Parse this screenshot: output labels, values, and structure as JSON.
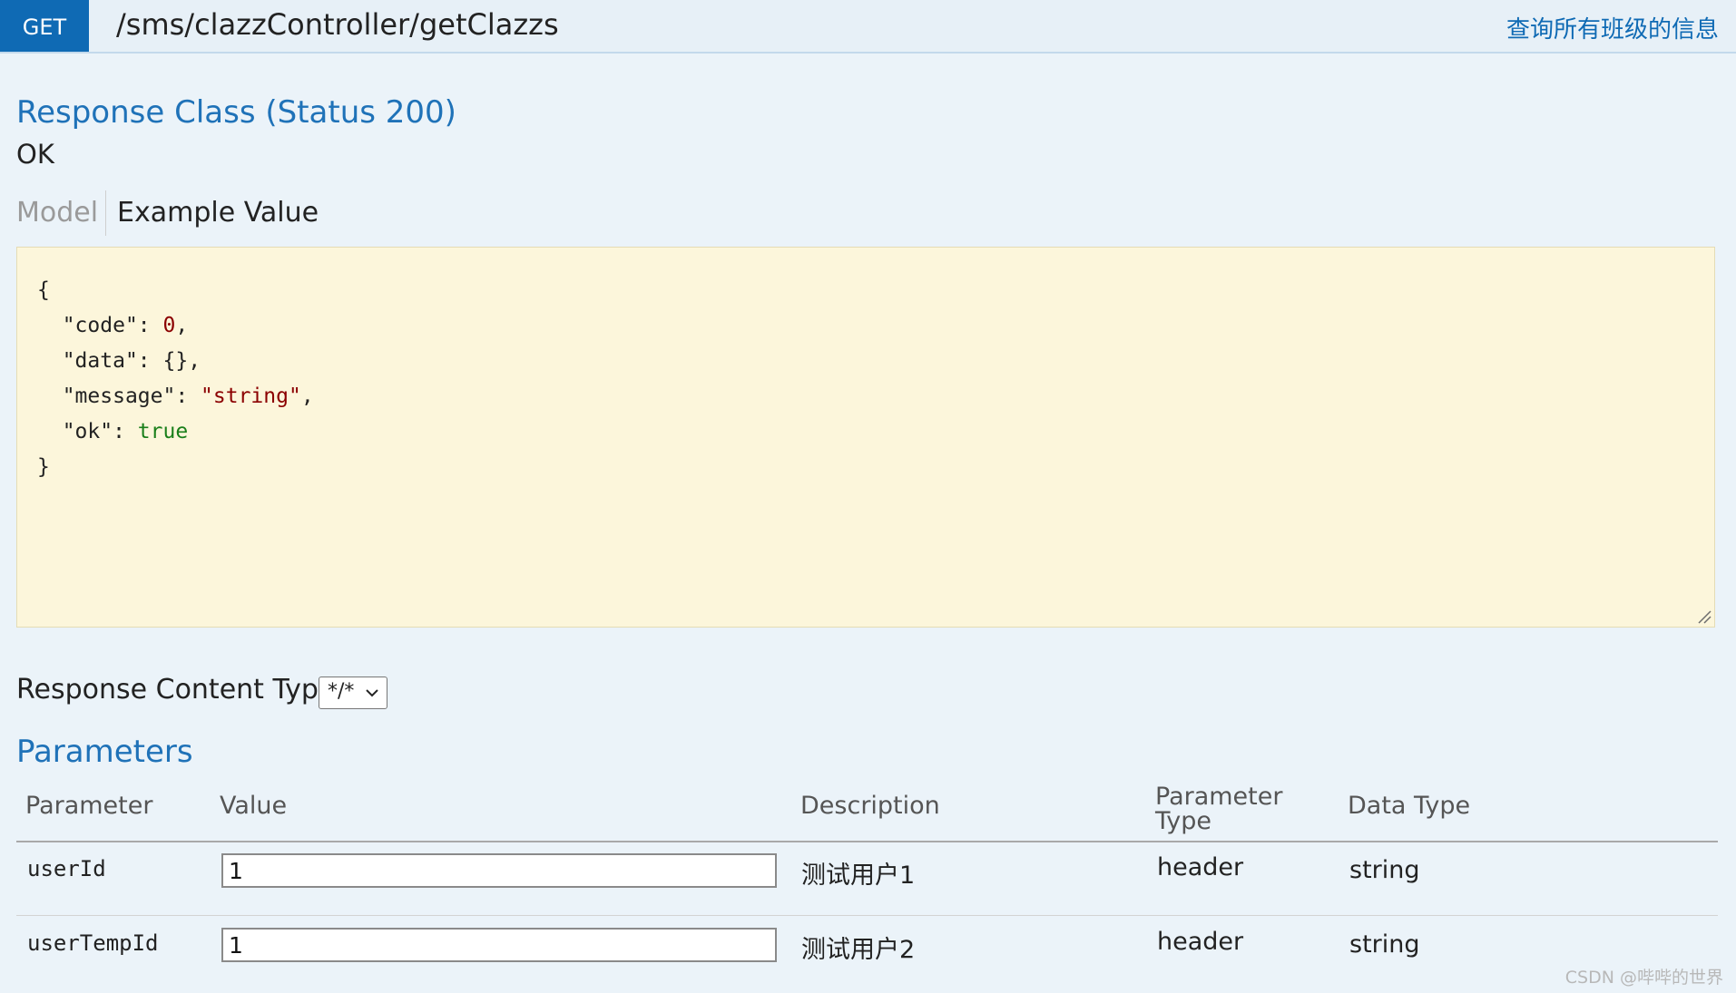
{
  "header": {
    "method": "GET",
    "path": "/sms/clazzController/getClazzs",
    "summary": "查询所有班级的信息"
  },
  "response_class": {
    "title": "Response Class (Status 200)",
    "status_text": "OK"
  },
  "tabs": {
    "model": "Model",
    "example_value": "Example Value"
  },
  "example_json": {
    "open": "{",
    "code_key": "\"code\"",
    "code_value": "0",
    "data_key": "\"data\"",
    "data_value": "{}",
    "message_key": "\"message\"",
    "message_value": "\"string\"",
    "ok_key": "\"ok\"",
    "ok_value": "true",
    "close": "}"
  },
  "response_content_type": {
    "label": "Response Content Type",
    "selected": "*/*"
  },
  "parameters": {
    "title": "Parameters",
    "headers": {
      "parameter": "Parameter",
      "value": "Value",
      "description": "Description",
      "parameter_type_line1": "Parameter",
      "parameter_type_line2": "Type",
      "data_type": "Data Type"
    },
    "rows": [
      {
        "name": "userId",
        "value": "1",
        "description": "测试用户1",
        "param_type": "header",
        "data_type": "string"
      },
      {
        "name": "userTempId",
        "value": "1",
        "description": "测试用户2",
        "param_type": "header",
        "data_type": "string"
      }
    ]
  },
  "watermark": "CSDN @哔哔的世界",
  "colors": {
    "method_badge": "#0f6ab4",
    "link_blue": "#1f72b8",
    "example_bg": "#fcf6db",
    "page_bg": "#ebf3f9",
    "number_value": "#8b0000",
    "boolean_value": "#1a7f1a"
  }
}
